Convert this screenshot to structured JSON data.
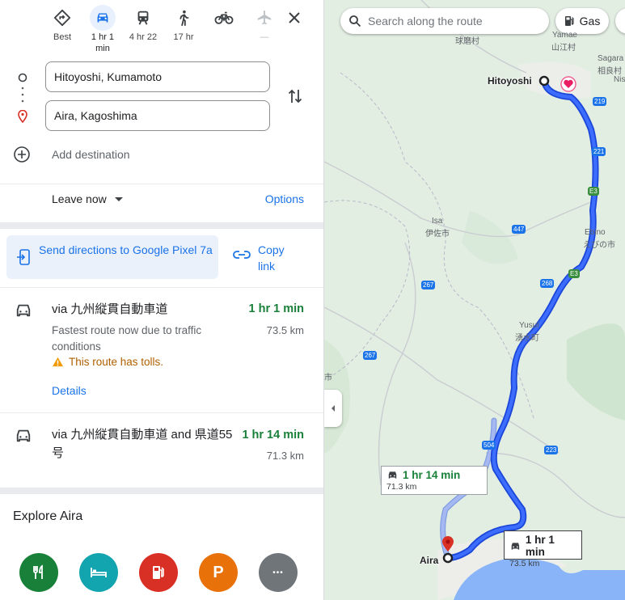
{
  "modes": [
    {
      "name": "best",
      "label": "Best"
    },
    {
      "name": "driving",
      "label": "1 hr 1 min"
    },
    {
      "name": "transit",
      "label": "4 hr 22"
    },
    {
      "name": "walking",
      "label": "17 hr"
    },
    {
      "name": "cycling",
      "label": ""
    },
    {
      "name": "flights",
      "label": "—"
    }
  ],
  "origin": "Hitoyoshi, Kumamoto",
  "destination": "Aira, Kagoshima",
  "add_destination": "Add destination",
  "leave_now": "Leave now",
  "options": "Options",
  "send_directions": "Send directions to Google Pixel 7a",
  "copy_link": "Copy link",
  "routes": [
    {
      "via": "via 九州縦貫自動車道",
      "time": "1 hr 1 min",
      "distance": "73.5 km",
      "description": "Fastest route now due to traffic conditions",
      "tolls": "This route has tolls.",
      "details": "Details"
    },
    {
      "via": "via 九州縦貫自動車道 and 県道55号",
      "time": "1 hr 14 min",
      "distance": "71.3 km"
    }
  ],
  "explore_title": "Explore Aira",
  "categories": [
    {
      "name": "restaurants",
      "color": "#188038"
    },
    {
      "name": "hotels",
      "color": "#12a4af"
    },
    {
      "name": "gas",
      "color": "#d93025"
    },
    {
      "name": "parking",
      "color": "#e8710a",
      "glyph": "P"
    },
    {
      "name": "more",
      "color": "#70757a",
      "glyph": "•••"
    }
  ],
  "map": {
    "search_placeholder": "Search along the route",
    "gas_chip": "Gas",
    "callout_fast": {
      "time": "1 hr 1 min",
      "distance": "73.5 km"
    },
    "callout_alt": {
      "time": "1 hr 14 min",
      "distance": "71.3 km"
    },
    "labels": {
      "hitoyoshi": "Hitoyoshi",
      "aira": "Aira",
      "kumamura": "球磨村",
      "yamae": "Yamae",
      "yamae_jp": "山江村",
      "sagara": "Sagara",
      "sagara_jp": "相良村",
      "nishiki": "Nis",
      "isa": "Isa",
      "isa_jp": "伊佐市",
      "ebino": "Ebino",
      "ebino_jp": "えびの市",
      "yusui": "Yusui",
      "yusui_jp": "湧水町",
      "edge_left": "市"
    },
    "route_shields": [
      "219",
      "221",
      "447",
      "268",
      "267",
      "267",
      "504",
      "223"
    ],
    "expressway_shields": [
      "E3",
      "E3"
    ]
  },
  "colors": {
    "accent": "#1a73e8",
    "route": "#1a5cff",
    "alt_route": "#a6b8f2",
    "time_green": "#188038"
  }
}
